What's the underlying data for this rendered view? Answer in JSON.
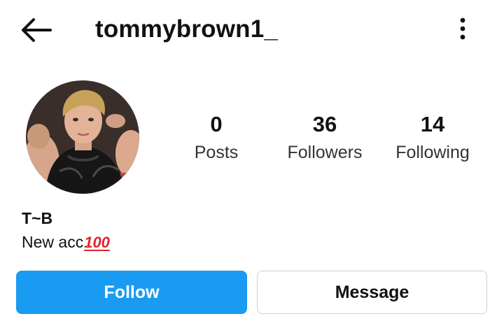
{
  "header": {
    "username": "tommybrown1_",
    "back_icon": "arrow-left-icon",
    "menu_icon": "more-vertical-icon"
  },
  "profile": {
    "avatar_icon": "profile-photo",
    "stats": [
      {
        "value": "0",
        "label": "Posts"
      },
      {
        "value": "36",
        "label": "Followers"
      },
      {
        "value": "14",
        "label": "Following"
      }
    ],
    "bio": {
      "name": "T~B",
      "text": "New acc",
      "emoji": "100"
    }
  },
  "actions": {
    "follow_label": "Follow",
    "message_label": "Message"
  },
  "colors": {
    "follow_button": "#1a9bf2",
    "emoji_red": "#e0242f"
  }
}
